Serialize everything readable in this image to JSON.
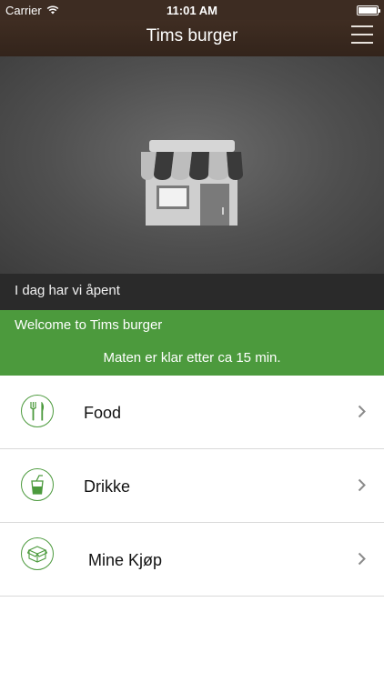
{
  "status_bar": {
    "carrier": "Carrier",
    "time": "11:01 AM"
  },
  "nav": {
    "title": "Tims burger"
  },
  "hero": {
    "image": "store-icon"
  },
  "open_status": "I dag har vi åpent",
  "welcome": {
    "title": "Welcome to Tims burger",
    "subtitle": "Maten er klar etter ca 15 min."
  },
  "menu": [
    {
      "label": "Food",
      "icon": "cutlery-icon"
    },
    {
      "label": "Drikke",
      "icon": "drink-cup-icon"
    },
    {
      "label": "Mine Kjøp",
      "icon": "box-icon"
    }
  ],
  "colors": {
    "nav_brown": "#3d2c22",
    "accent_green": "#4c9a3d",
    "open_bar": "#2a2a2a"
  }
}
